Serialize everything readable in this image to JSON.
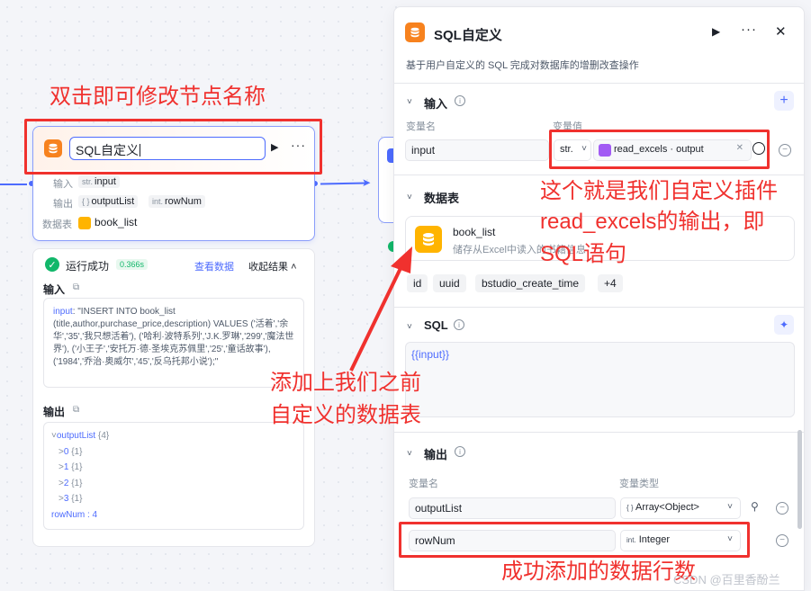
{
  "left_node": {
    "title": "SQL自定义",
    "input_label": "输入",
    "input_type": "str.",
    "input_name": "input",
    "output_label": "输出",
    "output_type1": "{ }",
    "output_name1": "outputList",
    "output_type2": "int.",
    "output_name2": "rowNum",
    "table_label": "数据表",
    "table_name": "book_list"
  },
  "run_result": {
    "status": "运行成功",
    "time": "0.366s",
    "view_data": "查看数据",
    "collapse": "收起结果",
    "input_title": "输入",
    "input_key": "input",
    "input_value": ": \"INSERT INTO book_list (title,author,purchase_price,description) VALUES ('活着','余华','35','我只想活着'), ('哈利·波特系列','J.K.罗琳','299','魔法世界'), ('小王子','安托万·德·圣埃克苏佩里','25','童话故事'), ('1984','乔治·奥威尔','45','反乌托邦小说');\"",
    "output_title": "输出",
    "output_list": "outputList",
    "output_list_count": "{4}",
    "items": [
      {
        "idx": "0",
        "v": "{1}"
      },
      {
        "idx": "1",
        "v": "{1}"
      },
      {
        "idx": "2",
        "v": "{1}"
      },
      {
        "idx": "3",
        "v": "{1}"
      }
    ],
    "row_num": "rowNum : 4"
  },
  "panel": {
    "title": "SQL自定义",
    "description": "基于用户自定义的 SQL 完成对数据库的增删改查操作",
    "input_section": "输入",
    "var_name_label": "变量名",
    "var_value_label": "变量值",
    "input_var_name": "input",
    "input_type_select": "str.",
    "ref_value": "read_excels · output",
    "table_section": "数据表",
    "db_name": "book_list",
    "db_desc": "储存从Excel中读入的书籍信息",
    "columns": [
      "id",
      "uuid",
      "bstudio_create_time",
      "+4"
    ],
    "sql_section": "SQL",
    "sql_text": "{{input}}",
    "output_section": "输出",
    "out_var_name_label": "变量名",
    "out_var_type_label": "变量类型",
    "outputs": [
      {
        "name": "outputList",
        "type": "Array<Object>",
        "type_prefix": "{ }"
      },
      {
        "name": "rowNum",
        "type": "Integer",
        "type_prefix": "int."
      }
    ]
  },
  "annotations": {
    "double_click": "双击即可修改节点名称",
    "plugin_output_1": "这个就是我们自定义插件",
    "plugin_output_2": "read_excels的输出，即",
    "plugin_output_3": "SQL语句",
    "table_added_1": "添加上我们之前",
    "table_added_2": "自定义的数据表",
    "row_count": "成功添加的数据行数"
  },
  "watermark": "CSDN @百里香酚兰",
  "colors": {
    "accent": "#4d6bfe",
    "annotation_red": "#f0312e",
    "success": "#12b76a",
    "sql_icon": "#f7821e",
    "db_icon": "#ffb400"
  }
}
